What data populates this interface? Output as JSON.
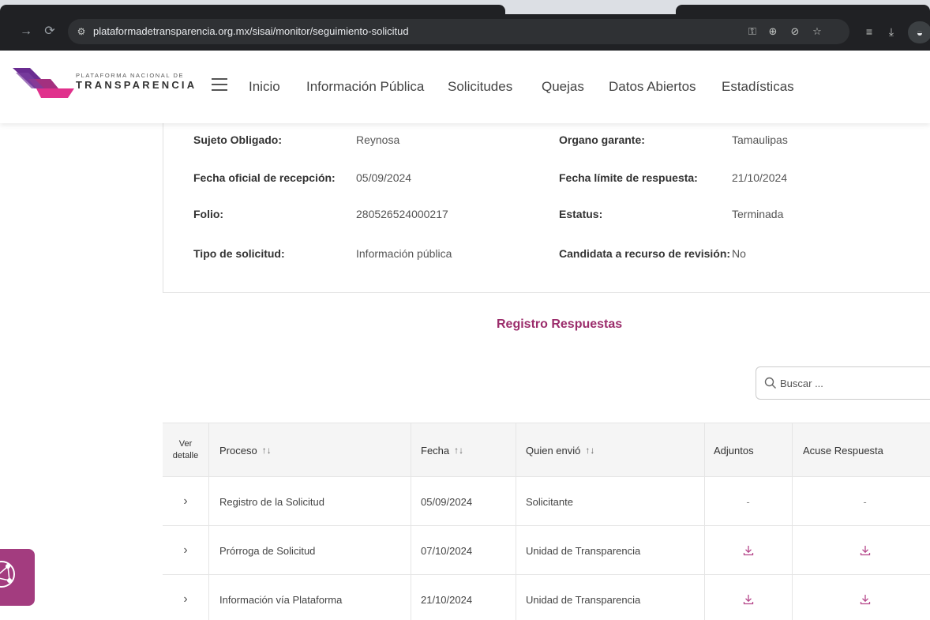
{
  "browser": {
    "url": "plataformadetransparencia.org.mx/sisai/monitor/seguimiento-solicitud",
    "nav": {
      "forward_icon": "forward-arrow-icon",
      "reload_icon": "reload-icon"
    },
    "omnibox_icons": [
      "password-key-icon",
      "zoom-icon",
      "eye-off-icon",
      "star-icon"
    ],
    "toolbar_icons": [
      "reading-list-icon",
      "download-icon",
      "incognito-icon"
    ]
  },
  "site": {
    "logo_small": "PLATAFORMA NACIONAL DE",
    "logo_big": "TRANSPARENCIA",
    "menu": [
      "Inicio",
      "Información Pública",
      "Solicitudes",
      "Quejas",
      "Datos Abiertos",
      "Estadísticas"
    ]
  },
  "details": {
    "sujeto_label": "Sujeto Obligado:",
    "sujeto_value": "Reynosa",
    "organo_label": "Organo garante:",
    "organo_value": "Tamaulipas",
    "recepcion_label": "Fecha oficial de recepción:",
    "recepcion_value": "05/09/2024",
    "limite_label": "Fecha límite de respuesta:",
    "limite_value": "21/10/2024",
    "folio_label": "Folio:",
    "folio_value": "280526524000217",
    "estatus_label": "Estatus:",
    "estatus_value": "Terminada",
    "tipo_label": "Tipo de solicitud:",
    "tipo_value": "Información pública",
    "candidata_label": "Candidata a recurso de revisión:",
    "candidata_value": "No"
  },
  "section_title": "Registro Respuestas",
  "search": {
    "placeholder": "Buscar ..."
  },
  "table": {
    "headers": {
      "ver_line1": "Ver",
      "ver_line2": "detalle",
      "proceso": "Proceso",
      "fecha": "Fecha",
      "quien": "Quien envió",
      "adjuntos": "Adjuntos",
      "acuse": "Acuse Respuesta",
      "sort_glyph": "↑↓"
    },
    "rows": [
      {
        "proceso": "Registro de la Solicitud",
        "fecha": "05/09/2024",
        "quien": "Solicitante",
        "adjuntos": "-",
        "acuse": "-"
      },
      {
        "proceso": "Prórroga de Solicitud",
        "fecha": "07/10/2024",
        "quien": "Unidad de Transparencia",
        "adjuntos": "download-icon",
        "acuse": "download-icon"
      },
      {
        "proceso": "Información vía Plataforma",
        "fecha": "21/10/2024",
        "quien": "Unidad de Transparencia",
        "adjuntos": "download-icon",
        "acuse": "download-icon"
      }
    ]
  },
  "colors": {
    "accent": "#9b2c6b",
    "download": "#b5468a",
    "float_button": "#a33c7f"
  }
}
